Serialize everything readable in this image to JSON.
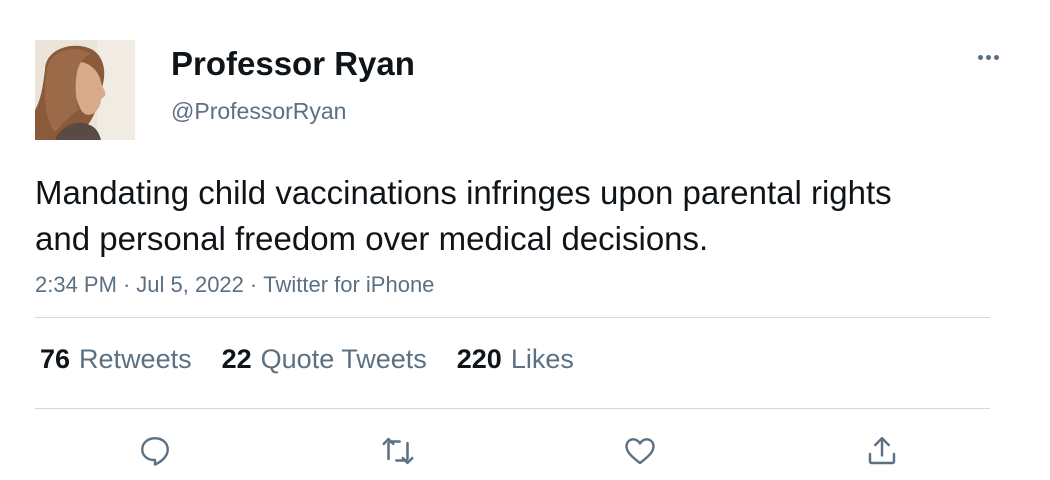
{
  "author": {
    "display_name": "Professor Ryan",
    "handle": "@ProfessorRyan"
  },
  "tweet": {
    "text": "Mandating child vaccinations infringes upon parental rights and personal freedom over medical decisions.",
    "time": "2:34 PM",
    "date": "Jul 5, 2022",
    "source": "Twitter for iPhone",
    "separator": "·"
  },
  "stats": {
    "retweets": {
      "count": "76",
      "label": "Retweets"
    },
    "quote_tweets": {
      "count": "22",
      "label": "Quote Tweets"
    },
    "likes": {
      "count": "220",
      "label": "Likes"
    }
  },
  "icons": {
    "more": "more-horizontal-icon",
    "reply": "reply-bubble-icon",
    "retweet": "retweet-arrows-icon",
    "like": "heart-icon",
    "share": "share-upload-icon"
  },
  "colors": {
    "text_primary": "#0f1419",
    "text_secondary": "#5b7083",
    "divider": "#cfd9de"
  }
}
